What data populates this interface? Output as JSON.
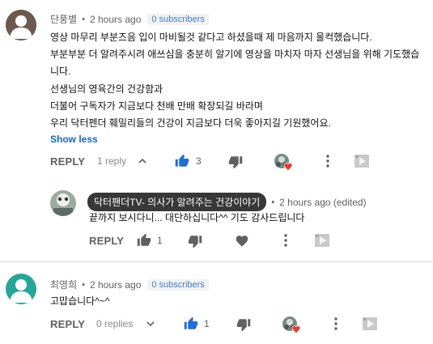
{
  "comments": [
    {
      "author": "단풍별",
      "time": "2 hours ago",
      "subscribers": "0 subscribers",
      "lines": [
        "영상 마무리 부분즈음  입이 마비될것 같다고 하셨을때 제 마음까지 울컥했습니다.",
        "부분부분 더 알려주시려 애쓰심을 충분히 알기에 영상을 마치자 마자 선생님을 위해 기도했습",
        "니다.",
        "선생님의 영육간의 건강함과",
        "더불어 구독자가 지금보다 천배 만배 확장되길 바라며",
        "우리 닥터펜더 훼밀리들의 건강이 지금보다 더욱 좋아지길 기원했어요."
      ],
      "show_less": "Show less",
      "reply_label": "REPLY",
      "replies": "1 reply",
      "likes": "3",
      "avatar_color": "#6d5a4e"
    },
    {
      "author": "닥터팬더TV- 의사가 알려주는 건강이야기",
      "time": "2 hours ago (edited)",
      "text": "끝까지 보시다니... 대단하십니다^^ 기도 감사드립니다",
      "reply_label": "REPLY",
      "likes": "1"
    },
    {
      "author": "최영희",
      "time": "2 hours ago",
      "subscribers": "0 subscribers",
      "text": "고맙습니다^~^",
      "reply_label": "REPLY",
      "replies": "0 replies",
      "likes": "1",
      "avatar_color": "#26a69a"
    }
  ],
  "separator": "•",
  "icons": {
    "like": "thumbs-up-icon",
    "dislike": "thumbs-down-icon",
    "more": "more-vertical-icon",
    "heart": "heart-icon",
    "chevron_up": "chevron-up-icon",
    "chevron_down": "chevron-down-icon"
  },
  "colors": {
    "like_active": "#1e6fd9",
    "heart": "#e53935",
    "link": "#1565c0"
  }
}
